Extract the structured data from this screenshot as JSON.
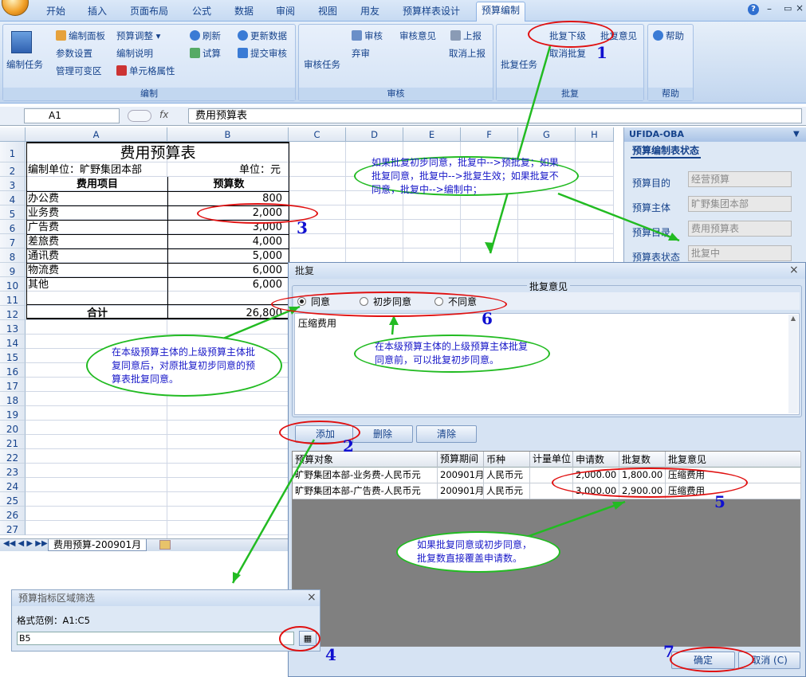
{
  "ribbon": {
    "tabs": [
      "开始",
      "插入",
      "页面布局",
      "公式",
      "数据",
      "审阅",
      "视图",
      "用友",
      "预算样表设计",
      "预算编制"
    ],
    "edit": {
      "big": "编制任务",
      "b1": "编制面板",
      "b2": "预算调整",
      "b3": "参数设置",
      "b4": "编制说明",
      "b5": "管理可变区",
      "b6": "单元格属性",
      "b7": "刷新",
      "b8": "试算",
      "b9": "更新数据",
      "b10": "提交审核",
      "label": "编制"
    },
    "review": {
      "big": "审核任务",
      "b1": "审核",
      "b2": "审核意见",
      "b3": "弃审",
      "b4": "上报",
      "b5": "取消上报",
      "label": "审核"
    },
    "approve": {
      "big": "批复任务",
      "b1": "批复下级",
      "b2": "批复意见",
      "b3": "取消批复",
      "label": "批复"
    },
    "help": {
      "b1": "帮助",
      "label": "帮助"
    }
  },
  "formula": {
    "name": "A1",
    "fx": "fx",
    "value": "费用预算表"
  },
  "sheet": {
    "cols": [
      "A",
      "B",
      "C",
      "D",
      "E",
      "F",
      "G",
      "H"
    ],
    "rows": [
      "1",
      "2",
      "3",
      "4",
      "5",
      "6",
      "7",
      "8",
      "9",
      "10",
      "11",
      "12",
      "13",
      "14",
      "15",
      "16",
      "17",
      "18",
      "19",
      "20",
      "21",
      "22",
      "23",
      "24",
      "25",
      "26",
      "27"
    ],
    "title": "费用预算表",
    "unit_left": "编制单位：旷野集团本部",
    "unit_right": "单位：元",
    "h1": "费用项目",
    "h2": "预算数",
    "items": [
      {
        "n": "办公费",
        "v": "800"
      },
      {
        "n": "业务费",
        "v": "2,000"
      },
      {
        "n": "广告费",
        "v": "3,000"
      },
      {
        "n": "差旅费",
        "v": "4,000"
      },
      {
        "n": "通讯费",
        "v": "5,000"
      },
      {
        "n": "物流费",
        "v": "6,000"
      },
      {
        "n": "其他",
        "v": "6,000"
      }
    ],
    "total_label": "合计",
    "total": "26,800",
    "tab": "费用预算-200901月"
  },
  "panel": {
    "title": "UFIDA-OBA",
    "tab": "预算编制表状态",
    "fields": [
      {
        "l": "预算目的",
        "v": "经营预算"
      },
      {
        "l": "预算主体",
        "v": "旷野集团本部"
      },
      {
        "l": "预算目录",
        "v": "费用预算表"
      },
      {
        "l": "预算表状态",
        "v": "批复中"
      }
    ]
  },
  "dialog": {
    "title": "批复",
    "legend": "批复意见",
    "radios": [
      "同意",
      "初步同意",
      "不同意"
    ],
    "opinion": "压缩费用",
    "buttons": {
      "add": "添加",
      "del": "删除",
      "clear": "清除",
      "ok": "确定",
      "cancel": "取消 (C)"
    },
    "headers": [
      "预算对象",
      "预算期间",
      "币种",
      "计量单位",
      "申请数",
      "批复数",
      "批复意见"
    ],
    "rows": [
      [
        "旷野集团本部-业务费-人民币元",
        "200901月",
        "人民币元",
        "",
        "2,000.00",
        "1,800.00",
        "压缩费用"
      ],
      [
        "旷野集团本部-广告费-人民币元",
        "200901月",
        "人民币元",
        "",
        "3,000.00",
        "2,900.00",
        "压缩费用"
      ]
    ]
  },
  "filter": {
    "title": "预算指标区域筛选",
    "hint": "格式范例：A1:C5",
    "value": "B5"
  },
  "annotations": {
    "a1": "如果批复初步同意，批复中-->预批复；如果批复同意，批复中-->批复生效；如果批复不同意，批复中-->编制中；",
    "a2": "在本级预算主体的上级预算主体批复同意后，对原批复初步同意的预算表批复同意。",
    "a3": "在本级预算主体的上级预算主体批复同意前，可以批复初步同意。",
    "a4": "如果批复同意或初步同意，批复数直接覆盖申请数。",
    "nums": [
      "1",
      "2",
      "3",
      "4",
      "5",
      "6",
      "7"
    ]
  },
  "colors": {
    "accent": "#15428b",
    "green": "#22bb22",
    "red": "#e01010"
  }
}
